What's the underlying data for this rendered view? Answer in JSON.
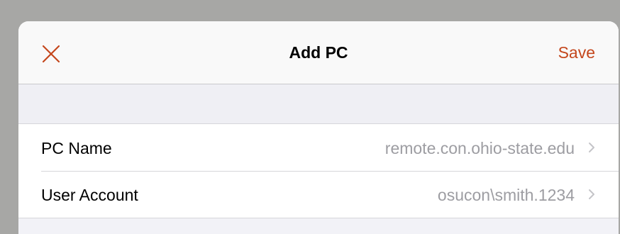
{
  "dialog": {
    "title": "Add PC",
    "save_label": "Save",
    "close_icon": "close-icon",
    "accent_color": "#c4471d"
  },
  "fields": [
    {
      "label": "PC Name",
      "value": "remote.con.ohio-state.edu"
    },
    {
      "label": "User Account",
      "value": "osucon\\smith.1234"
    }
  ]
}
